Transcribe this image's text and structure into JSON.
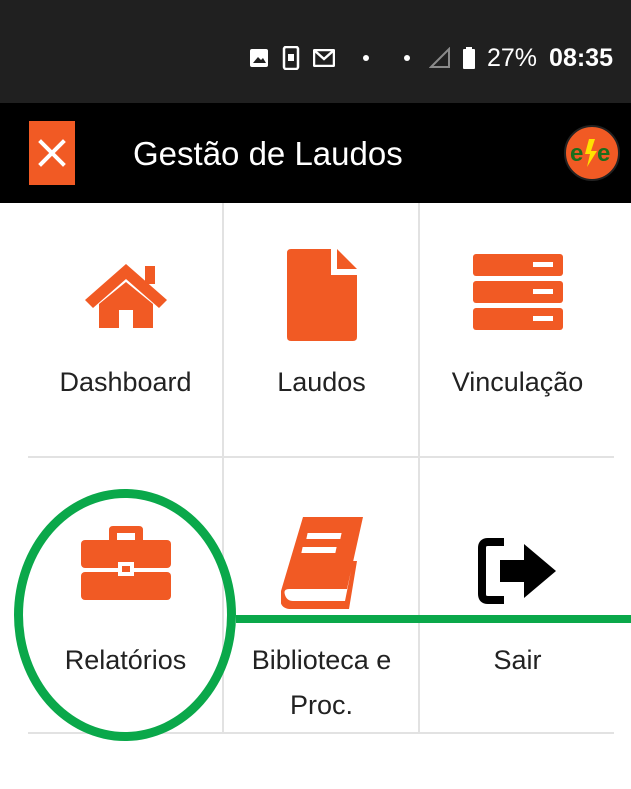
{
  "status_bar": {
    "battery_percent": "27%",
    "time": "08:35",
    "icons": [
      "image-icon",
      "phone-icon",
      "gmail-icon",
      "dot-icon",
      "dot-icon",
      "signal-icon",
      "battery-icon"
    ]
  },
  "app_bar": {
    "title": "Gestão de Laudos",
    "logo_text": "e/e"
  },
  "menu": {
    "items": [
      {
        "label": "Dashboard",
        "icon": "home-icon"
      },
      {
        "label": "Laudos",
        "icon": "document-icon"
      },
      {
        "label": "Vinculação",
        "icon": "server-icon"
      },
      {
        "label": "Relatórios",
        "icon": "briefcase-icon"
      },
      {
        "label": "Biblioteca e",
        "label2": "Proc.",
        "icon": "book-icon"
      },
      {
        "label": "Sair",
        "icon": "sign-out-icon"
      }
    ]
  },
  "colors": {
    "accent": "#f15a24",
    "annotation": "#0aa84a",
    "statusbar": "#202020",
    "appbar": "#000000"
  }
}
